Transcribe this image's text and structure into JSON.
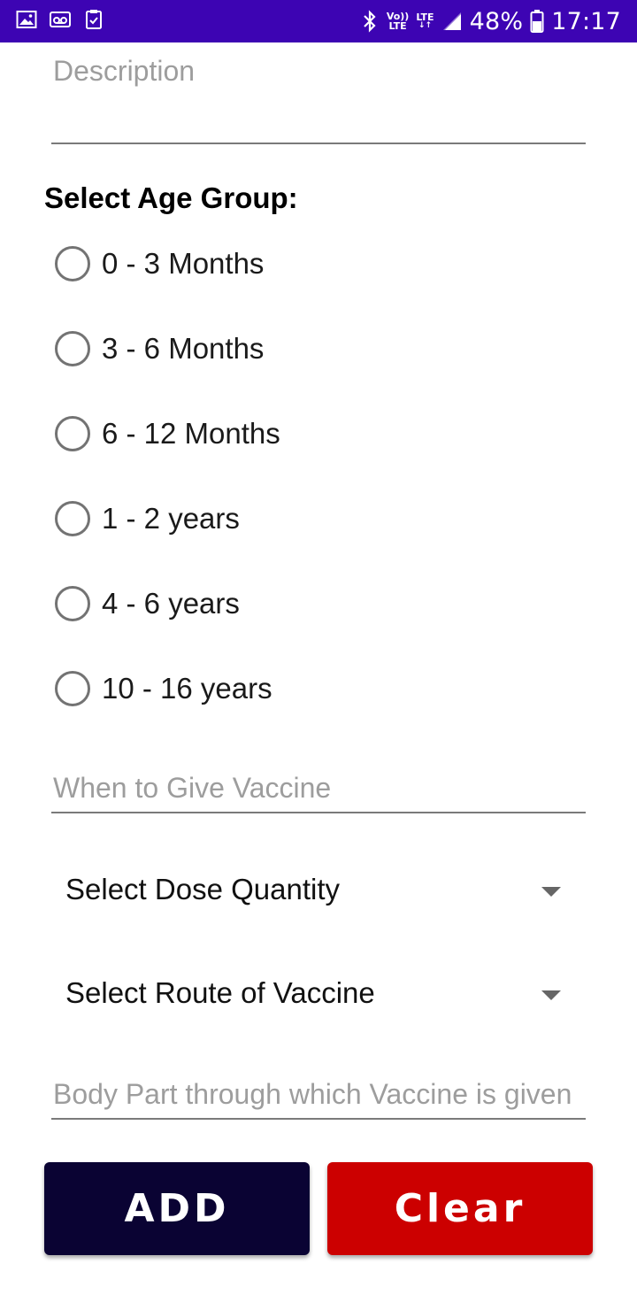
{
  "status_bar": {
    "battery": "48%",
    "time": "17:17",
    "volte_top": "Vo))",
    "volte_bottom": "LTE",
    "lte": "LTE",
    "background": "#3d04b3",
    "left_icons": [
      "image-icon",
      "voicemail-icon",
      "clipboard-check-icon"
    ],
    "right_icons": [
      "bluetooth-icon",
      "volte-icon",
      "lte-data-icon",
      "signal-icon",
      "battery-icon"
    ]
  },
  "form": {
    "description_hint": "Description",
    "age_group_label": "Select Age Group:",
    "age_groups": [
      {
        "label": "0 - 3 Months",
        "selected": false
      },
      {
        "label": "3 - 6 Months",
        "selected": false
      },
      {
        "label": "6 - 12 Months",
        "selected": false
      },
      {
        "label": "1 - 2 years",
        "selected": false
      },
      {
        "label": "4 - 6 years",
        "selected": false
      },
      {
        "label": "10 - 16 years",
        "selected": false
      }
    ],
    "when_hint": "When to Give Vaccine",
    "dose_spinner": "Select Dose Quantity",
    "route_spinner": "Select Route of Vaccine",
    "body_part_hint": "Body Part through which Vaccine is given"
  },
  "buttons": {
    "add": {
      "label": "ADD",
      "color": "#0a0333"
    },
    "clear": {
      "label": "Clear",
      "color": "#cc0000"
    }
  }
}
